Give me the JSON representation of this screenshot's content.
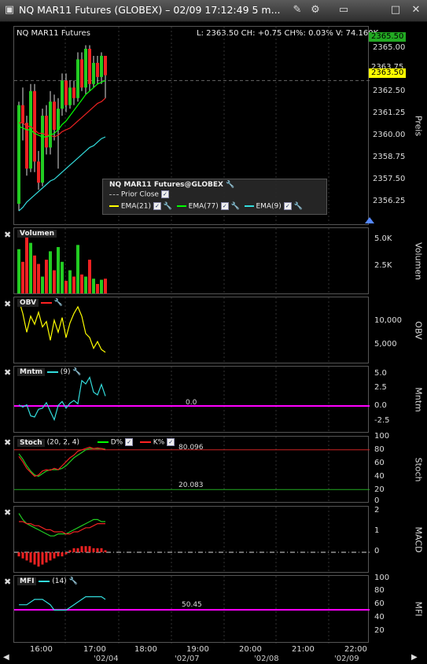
{
  "window": {
    "title": "NQ MAR11 Futures (GLOBEX) – 02/09 17:12:49 5 m..."
  },
  "main": {
    "symbol_label": "NQ MAR11 Futures",
    "quote_line": "L: 2363.50 CH: +0.75 CH%: 0.03% V: 74.160K",
    "price_axis_title": "Preis",
    "price_ticks": [
      "2365.00",
      "2362.50",
      "2361.25",
      "2360.00",
      "2358.75",
      "2357.50",
      "2356.25"
    ],
    "top_tag": "2365.50",
    "last_tag": "2363.50",
    "last_tag_under": "2363.75",
    "legend": {
      "title": "NQ MAR11 Futures@GLOBEX",
      "prior_close": "Prior Close",
      "ema21": "EMA(21)",
      "ema77": "EMA(77)",
      "ema9": "EMA(9)"
    },
    "colors": {
      "up": "#22cc22",
      "down": "#ee2222",
      "ema21": "#ffff00",
      "ema77": "#00ff00",
      "ema9": "#33dddd",
      "magenta": "#ff00ff"
    }
  },
  "volume": {
    "label": "Volumen",
    "title": "Volumen",
    "ticks": [
      "5.0K",
      "2.5K"
    ]
  },
  "obv": {
    "label": "OBV",
    "title": "OBV",
    "ticks": [
      "10,000",
      "5,000"
    ]
  },
  "mntm": {
    "label": "Mntm",
    "param": "(9)",
    "title": "Mntm",
    "ticks": [
      "5.0",
      "2.5",
      "0.0",
      "-2.5"
    ],
    "zero_label": "0.0"
  },
  "stoch": {
    "label": "Stoch",
    "param": "(20, 2, 4)",
    "d_label": "D%",
    "k_label": "K%",
    "level_label": "20.083",
    "top_level_label": "80.096",
    "title": "Stoch",
    "ticks": [
      "100",
      "80",
      "60",
      "40",
      "20",
      "0"
    ]
  },
  "macd": {
    "title": "MACD",
    "ticks": [
      "2",
      "1",
      "0"
    ]
  },
  "mfi": {
    "label": "MFI",
    "param": "(14)",
    "level_label": "50.45",
    "title": "MFI",
    "ticks": [
      "100",
      "80",
      "60",
      "40",
      "20"
    ]
  },
  "timeaxis": {
    "times": [
      "16:00",
      "17:00",
      "18:00",
      "19:00",
      "20:00",
      "21:00",
      "22:00"
    ],
    "dates": [
      "'02/04",
      "'02/07",
      "'02/08",
      "'02/09"
    ]
  },
  "chart_data": {
    "type": "candlestick",
    "candles": [
      [
        2356.2,
        2361.8,
        2355.8,
        2362.0
      ],
      [
        2361.8,
        2360.8,
        2359.8,
        2362.8
      ],
      [
        2360.8,
        2358.2,
        2357.8,
        2361.2
      ],
      [
        2358.2,
        2362.6,
        2358.0,
        2363.0
      ],
      [
        2362.6,
        2358.6,
        2358.0,
        2363.0
      ],
      [
        2358.6,
        2357.4,
        2357.0,
        2359.2
      ],
      [
        2357.4,
        2361.2,
        2357.2,
        2361.6
      ],
      [
        2361.2,
        2359.4,
        2359.0,
        2361.8
      ],
      [
        2359.4,
        2362.0,
        2359.0,
        2362.6
      ],
      [
        2362.0,
        2360.4,
        2359.8,
        2362.4
      ],
      [
        2360.4,
        2361.6,
        2358.2,
        2362.2
      ],
      [
        2361.6,
        2363.2,
        2361.2,
        2363.6
      ],
      [
        2363.2,
        2361.8,
        2361.4,
        2363.6
      ],
      [
        2361.8,
        2362.8,
        2361.6,
        2363.2
      ],
      [
        2362.8,
        2362.2,
        2361.8,
        2363.2
      ],
      [
        2362.2,
        2364.4,
        2362.0,
        2364.8
      ],
      [
        2364.4,
        2362.8,
        2362.6,
        2364.8
      ],
      [
        2362.8,
        2365.0,
        2362.4,
        2365.2
      ],
      [
        2365.0,
        2363.0,
        2362.6,
        2365.2
      ],
      [
        2363.0,
        2364.2,
        2362.8,
        2364.6
      ],
      [
        2364.2,
        2363.4,
        2363.0,
        2364.6
      ],
      [
        2363.4,
        2364.6,
        2363.0,
        2364.8
      ],
      [
        2364.6,
        2363.5,
        2362.2,
        2364.6
      ]
    ],
    "volume": [
      4200,
      3000,
      5800,
      4800,
      3600,
      2800,
      1600,
      3200,
      4000,
      2200,
      4400,
      3000,
      1200,
      2200,
      1600,
      4600,
      1800,
      1600,
      3200,
      1400,
      900,
      1300,
      1400
    ],
    "ema9": [
      2355.8,
      2356.0,
      2356.3,
      2356.5,
      2356.7,
      2356.9,
      2357.1,
      2357.3,
      2357.5,
      2357.6,
      2357.8,
      2358.0,
      2358.2,
      2358.4,
      2358.6,
      2358.8,
      2359.0,
      2359.2,
      2359.4,
      2359.5,
      2359.7,
      2359.9,
      2360.0
    ],
    "ema21": [
      2360.8,
      2360.8,
      2360.6,
      2360.6,
      2360.4,
      2360.2,
      2360.2,
      2360.1,
      2360.1,
      2360.0,
      2360.1,
      2360.3,
      2360.4,
      2360.5,
      2360.7,
      2360.9,
      2361.1,
      2361.3,
      2361.5,
      2361.7,
      2361.9,
      2362.0,
      2362.2
    ],
    "ema77": [
      2360.6,
      2360.5,
      2360.4,
      2360.4,
      2360.2,
      2360.1,
      2360.0,
      2360.0,
      2360.1,
      2360.2,
      2360.4,
      2360.7,
      2360.9,
      2361.2,
      2361.5,
      2361.8,
      2362.1,
      2362.4,
      2362.6,
      2362.8,
      2363.0,
      2363.1,
      2363.2
    ],
    "obv": [
      12000,
      10000,
      7200,
      9600,
      8400,
      10200,
      8000,
      8800,
      6000,
      9000,
      7200,
      9400,
      6400,
      8600,
      10000,
      11000,
      9600,
      7000,
      6400,
      4800,
      5800,
      4600,
      4200
    ],
    "mntm": [
      0.2,
      -0.2,
      0.2,
      -1.8,
      -2.0,
      -0.6,
      -0.4,
      0.6,
      -1.0,
      -2.5,
      0.1,
      0.8,
      -0.4,
      0.5,
      1.0,
      0.4,
      4.6,
      4.0,
      5.2,
      2.5,
      2.0,
      3.9,
      1.8
    ],
    "stoch_k": [
      70,
      62,
      52,
      46,
      40,
      42,
      48,
      50,
      49,
      52,
      50,
      56,
      62,
      68,
      72,
      78,
      80,
      82,
      84,
      82,
      83,
      82,
      80
    ],
    "stoch_d": [
      74,
      66,
      56,
      48,
      42,
      40,
      44,
      48,
      50,
      50,
      50,
      52,
      56,
      62,
      68,
      72,
      76,
      80,
      82,
      82,
      82,
      82,
      81
    ],
    "macd": [
      1.9,
      1.6,
      1.4,
      1.3,
      1.2,
      1.1,
      1.0,
      0.9,
      0.8,
      0.8,
      0.9,
      0.9,
      0.9,
      1.0,
      1.1,
      1.2,
      1.3,
      1.4,
      1.5,
      1.6,
      1.6,
      1.5,
      1.5
    ],
    "macd_sig": [
      1.5,
      1.5,
      1.4,
      1.4,
      1.3,
      1.3,
      1.2,
      1.1,
      1.1,
      1.0,
      1.0,
      1.0,
      0.9,
      0.9,
      1.0,
      1.0,
      1.1,
      1.2,
      1.2,
      1.3,
      1.4,
      1.4,
      1.4
    ],
    "macd_hist": [
      -0.2,
      -0.3,
      -0.4,
      -0.5,
      -0.6,
      -0.7,
      -0.6,
      -0.5,
      -0.4,
      -0.3,
      -0.2,
      -0.2,
      -0.1,
      0.1,
      0.2,
      0.2,
      0.3,
      0.3,
      0.3,
      0.2,
      0.2,
      0.2,
      0.1
    ],
    "mfi": [
      58,
      58,
      58,
      62,
      66,
      66,
      66,
      62,
      58,
      50,
      50,
      50,
      50,
      54,
      58,
      62,
      66,
      70,
      70,
      70,
      70,
      70,
      66
    ]
  }
}
